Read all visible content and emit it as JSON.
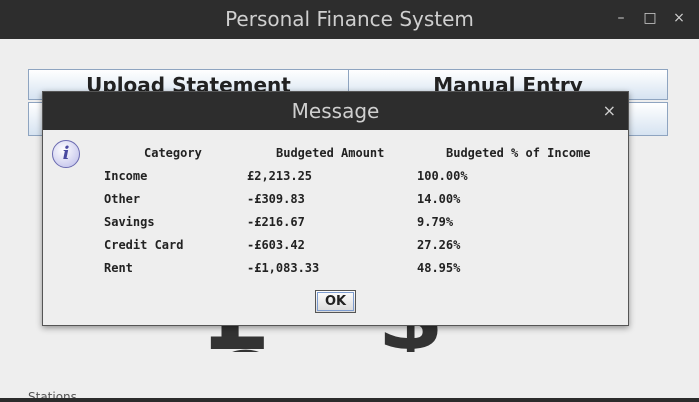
{
  "window": {
    "title": "Personal Finance System",
    "minimize": "–",
    "maximize": "□",
    "close": "×"
  },
  "main": {
    "upload_label": "Upload Statement",
    "manual_label": "Manual Entry",
    "currency_symbols": "£ $ €",
    "bottom_label": "Stations"
  },
  "dialog": {
    "title": "Message",
    "close": "×",
    "info_icon": "i",
    "ok_label": "OK",
    "table": {
      "headers": [
        "Category",
        "Budgeted Amount",
        "Budgeted % of Income"
      ],
      "rows": [
        [
          "Income",
          "£2,213.25",
          "100.00%"
        ],
        [
          "Other",
          "-£309.83",
          "14.00%"
        ],
        [
          "Savings",
          "-£216.67",
          "9.79%"
        ],
        [
          "Credit Card",
          "-£603.42",
          "27.26%"
        ],
        [
          "Rent",
          "-£1,083.33",
          "48.95%"
        ]
      ]
    }
  }
}
